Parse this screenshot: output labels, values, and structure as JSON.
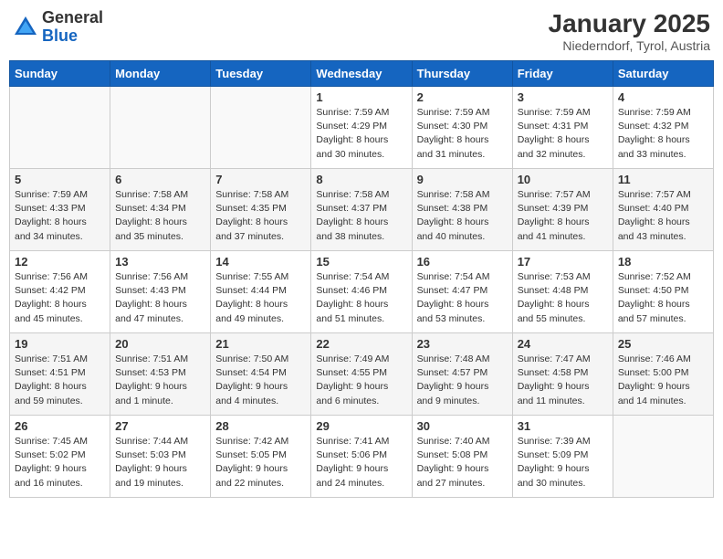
{
  "header": {
    "logo_line1": "General",
    "logo_line2": "Blue",
    "month": "January 2025",
    "location": "Niederndorf, Tyrol, Austria"
  },
  "weekdays": [
    "Sunday",
    "Monday",
    "Tuesday",
    "Wednesday",
    "Thursday",
    "Friday",
    "Saturday"
  ],
  "weeks": [
    [
      {
        "day": "",
        "info": ""
      },
      {
        "day": "",
        "info": ""
      },
      {
        "day": "",
        "info": ""
      },
      {
        "day": "1",
        "info": "Sunrise: 7:59 AM\nSunset: 4:29 PM\nDaylight: 8 hours\nand 30 minutes."
      },
      {
        "day": "2",
        "info": "Sunrise: 7:59 AM\nSunset: 4:30 PM\nDaylight: 8 hours\nand 31 minutes."
      },
      {
        "day": "3",
        "info": "Sunrise: 7:59 AM\nSunset: 4:31 PM\nDaylight: 8 hours\nand 32 minutes."
      },
      {
        "day": "4",
        "info": "Sunrise: 7:59 AM\nSunset: 4:32 PM\nDaylight: 8 hours\nand 33 minutes."
      }
    ],
    [
      {
        "day": "5",
        "info": "Sunrise: 7:59 AM\nSunset: 4:33 PM\nDaylight: 8 hours\nand 34 minutes."
      },
      {
        "day": "6",
        "info": "Sunrise: 7:58 AM\nSunset: 4:34 PM\nDaylight: 8 hours\nand 35 minutes."
      },
      {
        "day": "7",
        "info": "Sunrise: 7:58 AM\nSunset: 4:35 PM\nDaylight: 8 hours\nand 37 minutes."
      },
      {
        "day": "8",
        "info": "Sunrise: 7:58 AM\nSunset: 4:37 PM\nDaylight: 8 hours\nand 38 minutes."
      },
      {
        "day": "9",
        "info": "Sunrise: 7:58 AM\nSunset: 4:38 PM\nDaylight: 8 hours\nand 40 minutes."
      },
      {
        "day": "10",
        "info": "Sunrise: 7:57 AM\nSunset: 4:39 PM\nDaylight: 8 hours\nand 41 minutes."
      },
      {
        "day": "11",
        "info": "Sunrise: 7:57 AM\nSunset: 4:40 PM\nDaylight: 8 hours\nand 43 minutes."
      }
    ],
    [
      {
        "day": "12",
        "info": "Sunrise: 7:56 AM\nSunset: 4:42 PM\nDaylight: 8 hours\nand 45 minutes."
      },
      {
        "day": "13",
        "info": "Sunrise: 7:56 AM\nSunset: 4:43 PM\nDaylight: 8 hours\nand 47 minutes."
      },
      {
        "day": "14",
        "info": "Sunrise: 7:55 AM\nSunset: 4:44 PM\nDaylight: 8 hours\nand 49 minutes."
      },
      {
        "day": "15",
        "info": "Sunrise: 7:54 AM\nSunset: 4:46 PM\nDaylight: 8 hours\nand 51 minutes."
      },
      {
        "day": "16",
        "info": "Sunrise: 7:54 AM\nSunset: 4:47 PM\nDaylight: 8 hours\nand 53 minutes."
      },
      {
        "day": "17",
        "info": "Sunrise: 7:53 AM\nSunset: 4:48 PM\nDaylight: 8 hours\nand 55 minutes."
      },
      {
        "day": "18",
        "info": "Sunrise: 7:52 AM\nSunset: 4:50 PM\nDaylight: 8 hours\nand 57 minutes."
      }
    ],
    [
      {
        "day": "19",
        "info": "Sunrise: 7:51 AM\nSunset: 4:51 PM\nDaylight: 8 hours\nand 59 minutes."
      },
      {
        "day": "20",
        "info": "Sunrise: 7:51 AM\nSunset: 4:53 PM\nDaylight: 9 hours\nand 1 minute."
      },
      {
        "day": "21",
        "info": "Sunrise: 7:50 AM\nSunset: 4:54 PM\nDaylight: 9 hours\nand 4 minutes."
      },
      {
        "day": "22",
        "info": "Sunrise: 7:49 AM\nSunset: 4:55 PM\nDaylight: 9 hours\nand 6 minutes."
      },
      {
        "day": "23",
        "info": "Sunrise: 7:48 AM\nSunset: 4:57 PM\nDaylight: 9 hours\nand 9 minutes."
      },
      {
        "day": "24",
        "info": "Sunrise: 7:47 AM\nSunset: 4:58 PM\nDaylight: 9 hours\nand 11 minutes."
      },
      {
        "day": "25",
        "info": "Sunrise: 7:46 AM\nSunset: 5:00 PM\nDaylight: 9 hours\nand 14 minutes."
      }
    ],
    [
      {
        "day": "26",
        "info": "Sunrise: 7:45 AM\nSunset: 5:02 PM\nDaylight: 9 hours\nand 16 minutes."
      },
      {
        "day": "27",
        "info": "Sunrise: 7:44 AM\nSunset: 5:03 PM\nDaylight: 9 hours\nand 19 minutes."
      },
      {
        "day": "28",
        "info": "Sunrise: 7:42 AM\nSunset: 5:05 PM\nDaylight: 9 hours\nand 22 minutes."
      },
      {
        "day": "29",
        "info": "Sunrise: 7:41 AM\nSunset: 5:06 PM\nDaylight: 9 hours\nand 24 minutes."
      },
      {
        "day": "30",
        "info": "Sunrise: 7:40 AM\nSunset: 5:08 PM\nDaylight: 9 hours\nand 27 minutes."
      },
      {
        "day": "31",
        "info": "Sunrise: 7:39 AM\nSunset: 5:09 PM\nDaylight: 9 hours\nand 30 minutes."
      },
      {
        "day": "",
        "info": ""
      }
    ]
  ]
}
